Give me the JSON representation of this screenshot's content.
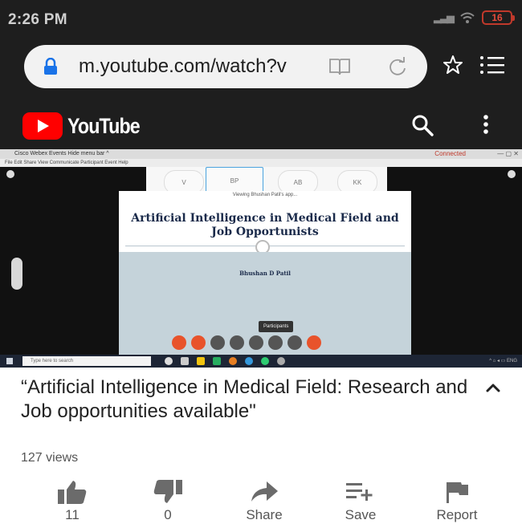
{
  "status_bar": {
    "time": "2:26 PM",
    "battery": "16"
  },
  "browser": {
    "url": "m.youtube.com/watch?v"
  },
  "youtube": {
    "logo_text": "YouTube",
    "brand_color": "#ff0000"
  },
  "video_frame": {
    "window_title": "Cisco Webex Events   Hide menu bar ^",
    "window_status": "Connected",
    "window_menu": "File  Edit  Share  View  Communicate  Participant  Event  Help",
    "participants": [
      "V",
      "BP",
      "AB",
      "KK"
    ],
    "viewing_text": "Viewing Bhushan Patil's app...",
    "slide_title": "Artificial Intelligence in Medical Field and Job Opportunists",
    "slide_author": "Bhushan D Patil",
    "tooltip": "Participants",
    "taskbar_search": "Type here to search"
  },
  "video": {
    "title": "“Artificial Intelligence in Medical Field: Research and Job opportunities available\"",
    "views": "127 views"
  },
  "actions": {
    "like": "11",
    "dislike": "0",
    "share": "Share",
    "save": "Save",
    "report": "Report"
  }
}
